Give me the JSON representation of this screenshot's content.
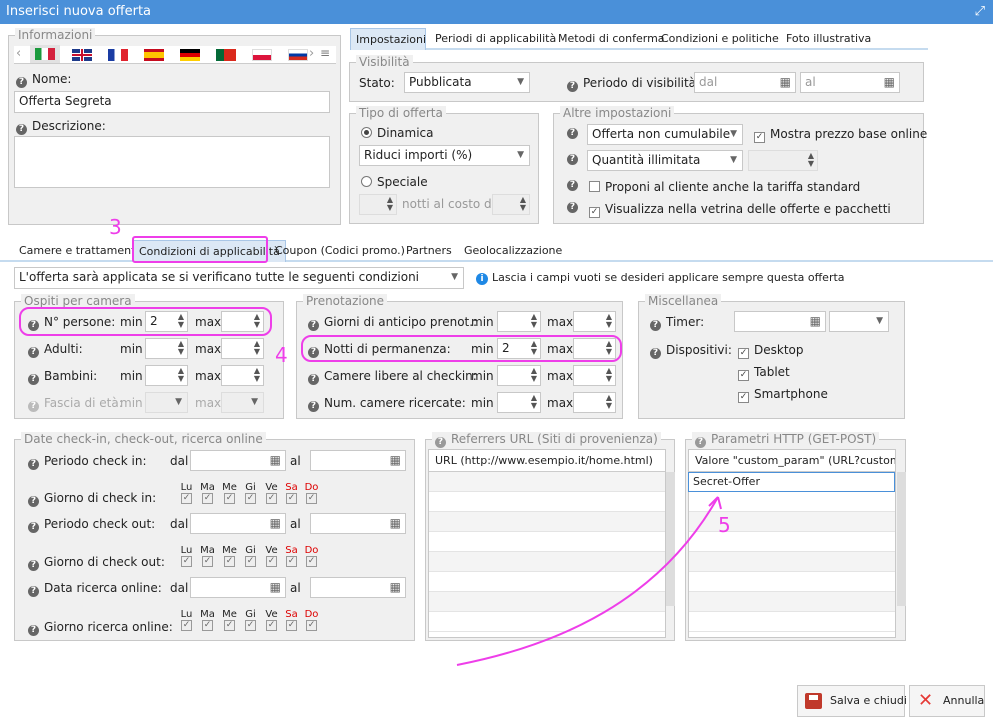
{
  "window": {
    "title": "Inserisci nuova offerta"
  },
  "informazioni": {
    "legend": "Informazioni",
    "nome_label": "Nome:",
    "nome_value": "Offerta Segreta",
    "descrizione_label": "Descrizione:"
  },
  "top_tabs": [
    "Impostazioni",
    "Periodi di applicabilità",
    "Metodi di conferma",
    "Condizioni e politiche",
    "Foto illustrativa"
  ],
  "visibilita": {
    "legend": "Visibilità",
    "stato_label": "Stato:",
    "stato_value": "Pubblicata",
    "periodo_label": "Periodo di visibilità:",
    "dal_placeholder": "dal",
    "al_placeholder": "al"
  },
  "tipo_offerta": {
    "legend": "Tipo di offerta",
    "dinamica": "Dinamica",
    "dinamica_select": "Riduci importi (%)",
    "speciale": "Speciale",
    "notti_label": "notti al costo di"
  },
  "altre": {
    "legend": "Altre impostazioni",
    "cumulabile": "Offerta non cumulabile",
    "mostra_prezzo": "Mostra prezzo base online",
    "quantita": "Quantità illimitata",
    "proponi": "Proponi al cliente anche la tariffa standard",
    "visualizza": "Visualizza nella vetrina delle offerte e pacchetti"
  },
  "bottom_tabs": [
    "Camere e trattamenti",
    "Condizioni di applicabilità",
    "Coupon (Codici promo.)",
    "Partners",
    "Geolocalizzazione"
  ],
  "condizioni": {
    "select_value": "L'offerta sarà applicata se si verificano tutte le seguenti condizioni",
    "info": "Lascia i campi vuoti se desideri applicare sempre questa offerta"
  },
  "ospiti": {
    "legend": "Ospiti per camera",
    "rows": [
      {
        "label": "N° persone:",
        "min": "2",
        "max": ""
      },
      {
        "label": "Adulti:",
        "min": "",
        "max": ""
      },
      {
        "label": "Bambini:",
        "min": "",
        "max": ""
      },
      {
        "label": "Fascia di età:",
        "min": "",
        "max": ""
      }
    ],
    "min_label": "min",
    "max_label": "max"
  },
  "prenotazione": {
    "legend": "Prenotazione",
    "rows": [
      {
        "label": "Giorni di anticipo prenot.:",
        "min": "",
        "max": ""
      },
      {
        "label": "Notti di permanenza:",
        "min": "2",
        "max": ""
      },
      {
        "label": "Camere libere al checkin:",
        "min": "",
        "max": ""
      },
      {
        "label": "Num. camere ricercate:",
        "min": "",
        "max": ""
      }
    ]
  },
  "misc": {
    "legend": "Miscellanea",
    "timer": "Timer:",
    "dispositivi": "Dispositivi:",
    "devices": [
      "Desktop",
      "Tablet",
      "Smartphone"
    ]
  },
  "date": {
    "legend": "Date check-in, check-out, ricerca online",
    "periodo_checkin": "Periodo check in:",
    "giorno_checkin": "Giorno di check in:",
    "periodo_checkout": "Periodo check out:",
    "giorno_checkout": "Giorno di check out:",
    "data_ricerca": "Data ricerca online:",
    "giorno_ricerca": "Giorno ricerca online:",
    "dal": "dal",
    "al": "al",
    "days": [
      "Lu",
      "Ma",
      "Me",
      "Gi",
      "Ve",
      "Sa",
      "Do"
    ]
  },
  "referrers": {
    "legend": "Referrers URL (Siti di provenienza)",
    "header": "URL (http://www.esempio.it/home.html)"
  },
  "http": {
    "legend": "Parametri HTTP (GET-POST)",
    "header": "Valore \"custom_param\" (URL?custom_par",
    "value": "Secret-Offer"
  },
  "annotations": {
    "n3": "3",
    "n4": "4",
    "n5": "5"
  },
  "buttons": {
    "salva": "Salva e chiudi",
    "annulla": "Annulla"
  },
  "colors": {
    "titlebar": "#4a90d9",
    "highlight": "#ee3ee9",
    "info": "#1e88e5"
  }
}
